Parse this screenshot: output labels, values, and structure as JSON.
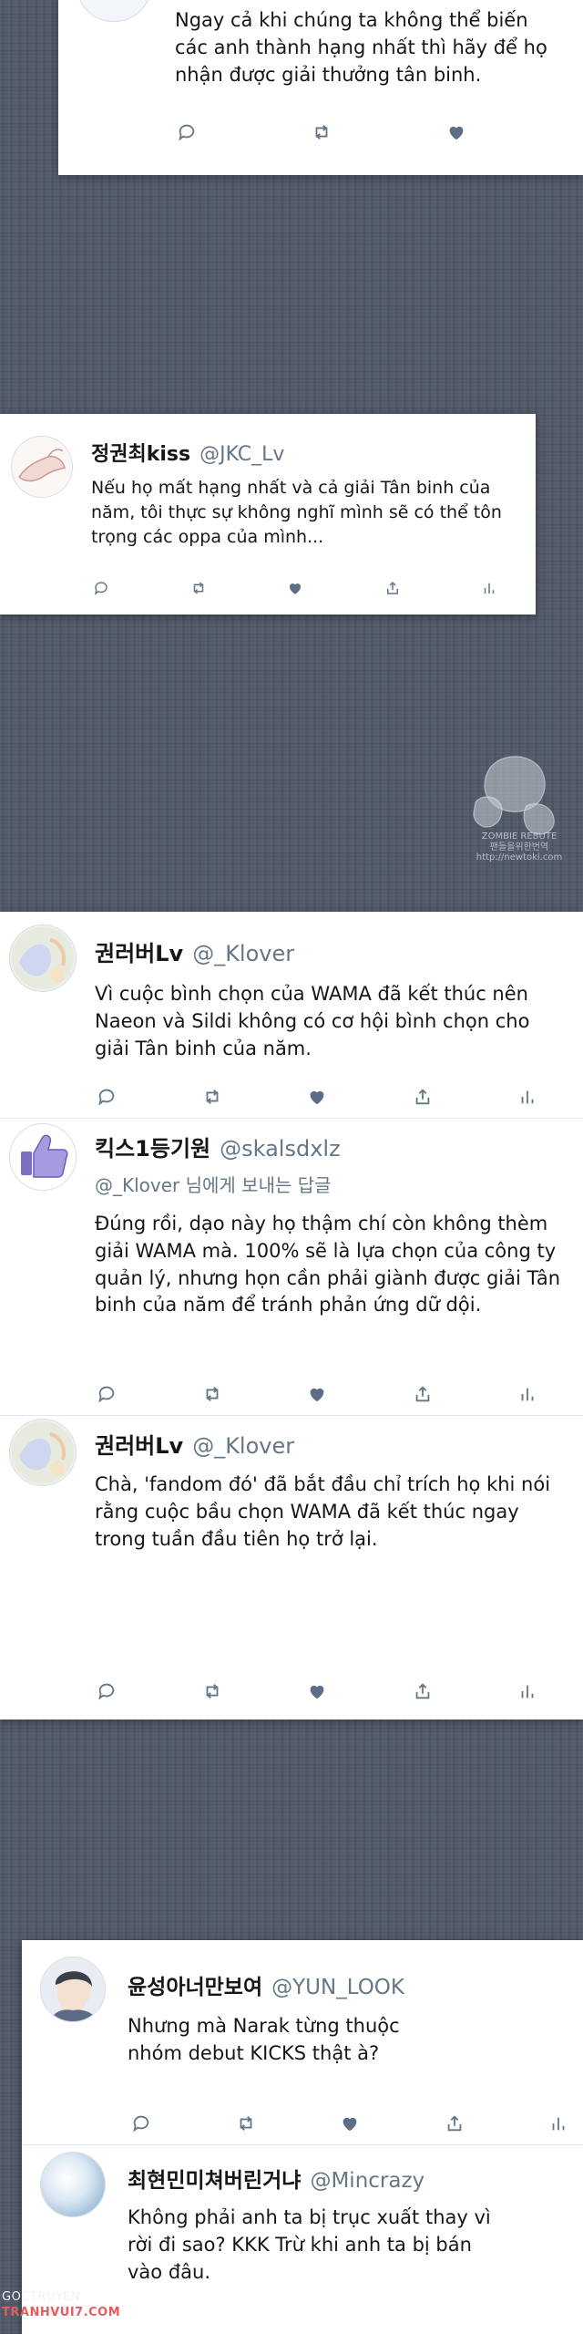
{
  "watermark": {
    "lines": [
      "ZOMBIE REBUTE",
      "팬들을위한번역",
      "http://newtoki.com"
    ]
  },
  "site_credit": {
    "line1": "GOCTRUYEN",
    "line2": "TRANHVUI7.COM"
  },
  "colors": {
    "background": "#4f5866",
    "card": "#ffffff",
    "handle": "#657786",
    "icon": "#657786",
    "liked": "#5b6e86"
  },
  "tweets": [
    {
      "display_name": "",
      "handle": "",
      "text": "Ngay cả khi chúng ta không thể biến các anh thành hạng nhất thì hãy để họ nhận được giải thưởng tân binh.",
      "avatar_icon": "illustration-avatar",
      "liked": true
    },
    {
      "display_name": "정권최kiss",
      "handle": "@JKC_Lv",
      "text": "Nếu họ mất hạng nhất và cả giải Tân binh của năm, tôi thực sự không nghĩ mình sẽ có thể tôn trọng các oppa của mình...",
      "avatar_icon": "hand-drawing-avatar",
      "liked": true
    },
    {
      "display_name": "권러버Lv",
      "handle": "@_Klover",
      "text": "Vì cuộc bình chọn của WAMA đã kết thúc nên Naeon và Sildi không có cơ hội bình chọn cho giải Tân binh của năm.",
      "avatar_icon": "pastel-photo-avatar",
      "liked": true
    },
    {
      "display_name": "킥스1등기원",
      "handle": "@skalsdxlz",
      "reply_to": "@_Klover 님에게 보내는 답글",
      "text": "Đúng rồi, dạo này họ thậm chí còn không thèm giải WAMA mà. 100% sẽ là lựa chọn của công ty quản lý, nhưng họn cần phải giành được giải Tân binh của năm để tránh phản ứng dữ dội.",
      "avatar_icon": "thumbs-up-avatar",
      "liked": true
    },
    {
      "display_name": "권러버Lv",
      "handle": "@_Klover",
      "text": "Chà, 'fandom đó' đã bắt đầu chỉ trích họ khi nói rằng cuộc bầu chọn WAMA đã kết thúc ngay trong tuần đầu tiên họ trở lại.",
      "avatar_icon": "pastel-photo-avatar",
      "liked": true
    },
    {
      "display_name": "윤성아너만보여",
      "handle": "@YUN_LOOK",
      "text": "Nhưng mà Narak từng thuộc nhóm debut KICKS thật à?",
      "avatar_icon": "person-photo-avatar",
      "liked": true
    },
    {
      "display_name": "최현민미쳐버린거냐",
      "handle": "@Mincrazy",
      "text": "Không phải anh ta bị trục xuất thay vì rời đi sao? KKK Trừ khi anh ta bị bán vào đâu.",
      "avatar_icon": "gradient-circle-avatar",
      "liked": false
    }
  ]
}
